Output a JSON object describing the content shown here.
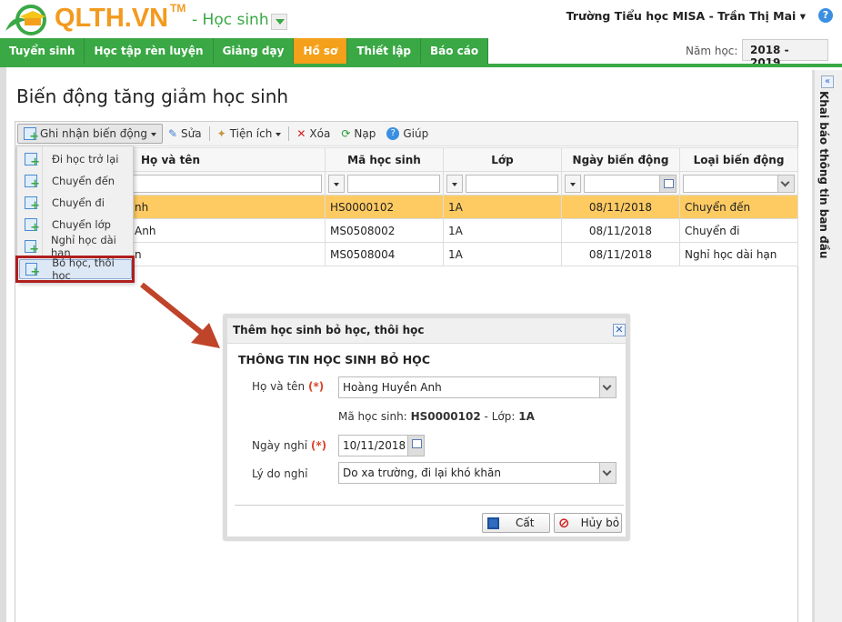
{
  "header": {
    "brand": "QLTH.VN",
    "tm": "TM",
    "module": "- Học sinh",
    "user": "Trường Tiểu học MISA - Trần Thị Mai",
    "year_label": "Năm học:",
    "year_value": "2018 - 2019"
  },
  "nav": {
    "tabs": [
      {
        "label": "Tuyển sinh"
      },
      {
        "label": "Học tập rèn luyện"
      },
      {
        "label": "Giảng dạy"
      },
      {
        "label": "Hồ sơ",
        "active": true
      },
      {
        "label": "Thiết lập"
      },
      {
        "label": "Báo cáo"
      }
    ]
  },
  "page": {
    "title": "Biến động tăng giảm học sinh",
    "side_panel": "Khai báo thông tin ban đầu"
  },
  "toolbar": {
    "record": "Ghi nhận biến động",
    "edit": "Sửa",
    "utilities": "Tiện ích",
    "delete": "Xóa",
    "reload": "Nạp",
    "help": "Giúp"
  },
  "menu": {
    "items": [
      "Đi học trở lại",
      "Chuyển đến",
      "Chuyển đi",
      "Chuyển lớp",
      "Nghỉ học dài hạn",
      "Bỏ học, thôi học"
    ],
    "highlighted": "Bỏ học, thôi học"
  },
  "grid": {
    "columns": [
      "Họ và tên",
      "Mã học sinh",
      "Lớp",
      "Ngày biến động",
      "Loại biến động"
    ],
    "rows": [
      {
        "name_visible": "nh",
        "code": "HS0000102",
        "class": "1A",
        "date": "08/11/2018",
        "type": "Chuyển đến",
        "selected": true
      },
      {
        "name_visible": "Anh",
        "code": "MS0508002",
        "class": "1A",
        "date": "08/11/2018",
        "type": "Chuyển đi"
      },
      {
        "name_visible": "n",
        "code": "MS0508004",
        "class": "1A",
        "date": "08/11/2018",
        "type": "Nghỉ học dài hạn"
      }
    ]
  },
  "dialog": {
    "title": "Thêm học sinh bỏ học, thôi học",
    "section": "THÔNG TIN HỌC SINH BỎ HỌC",
    "name_label": "Họ và tên",
    "required": "(*)",
    "name_value": "Hoàng Huyền Anh",
    "code_label": "Mã học sinh:",
    "code_value": "HS0000102",
    "sep": "-",
    "class_label": "Lớp:",
    "class_value": "1A",
    "date_label": "Ngày nghỉ",
    "date_value": "10/11/2018",
    "reason_label": "Lý do nghỉ",
    "reason_value": "Do xa trường, đi lại khó khăn",
    "save": "Cất",
    "cancel": "Hủy bỏ"
  },
  "colors": {
    "green": "#3aa845",
    "orange": "#f5a01a",
    "selected_row": "#fecb63",
    "highlight_box": "#b01e1e",
    "arrow": "#c0442a"
  }
}
